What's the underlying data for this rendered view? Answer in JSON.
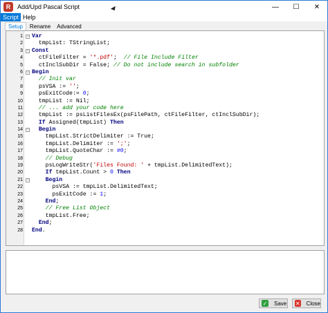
{
  "window": {
    "title": "Add/Upd Pascal Script",
    "minimize_glyph": "—",
    "maximize_glyph": "☐",
    "close_glyph": "✕",
    "app_icon_letter": "R",
    "app_icon_color": "#c0392b"
  },
  "menu": [
    {
      "label": "Script",
      "active": true
    },
    {
      "label": "Help",
      "active": false
    }
  ],
  "tabs": [
    {
      "label": "Setup",
      "active": true
    },
    {
      "label": "Rename",
      "active": false
    },
    {
      "label": "Advanced",
      "active": false
    }
  ],
  "editor": {
    "lines": [
      {
        "n": "1",
        "html": "<span class=\"kw\">Var</span>"
      },
      {
        "n": "2",
        "html": "  tmpList: TStringList;"
      },
      {
        "n": "3",
        "html": "<span class=\"kw\">Const</span>"
      },
      {
        "n": "4",
        "html": "  ctFileFilter = <span class=\"str\">'*.pdf'</span>;  <span class=\"cm\">// File Include Filter</span>"
      },
      {
        "n": "5",
        "html": "  ctInclSubDir = False; <span class=\"cm\">// Do not include search in subfolder</span>"
      },
      {
        "n": "6",
        "html": "<span class=\"kw\">Begin</span>"
      },
      {
        "n": "7",
        "html": "  <span class=\"cm\">// Init var</span>"
      },
      {
        "n": "8",
        "html": "  psVSA := <span class=\"str\">''</span>;"
      },
      {
        "n": "9",
        "html": "  psExitCode:= <span class=\"num\">0</span>;"
      },
      {
        "n": "10",
        "html": "  tmpList := Nil;"
      },
      {
        "n": "11",
        "html": "  <span class=\"cm\">// ... add your code here</span>"
      },
      {
        "n": "12",
        "html": "  tmpList := psListFilesEx(psFilePath, ctFileFilter, ctInclSubDir);"
      },
      {
        "n": "13",
        "html": "  <span class=\"kw\">If</span> Assigned(tmpList) <span class=\"kw\">Then</span>"
      },
      {
        "n": "14",
        "html": "  <span class=\"kw\">Begin</span>"
      },
      {
        "n": "15",
        "html": "    tmpList.StrictDelimiter := True;"
      },
      {
        "n": "16",
        "html": "    tmpList.Delimiter := <span class=\"str\">';'</span>;"
      },
      {
        "n": "17",
        "html": "    tmpList.QuoteChar := <span class=\"num\">#0</span>;"
      },
      {
        "n": "18",
        "html": "    <span class=\"cm\">// Debug</span>"
      },
      {
        "n": "19",
        "html": "    psLogWriteStr(<span class=\"str\">'Files Found: '</span> + tmpList.DelimitedText);"
      },
      {
        "n": "20",
        "html": "    <span class=\"kw\">If</span> tmpList.Count > <span class=\"num\">0</span> <span class=\"kw\">Then</span>"
      },
      {
        "n": "21",
        "html": "    <span class=\"kw\">Begin</span>"
      },
      {
        "n": "22",
        "html": "      psVSA := tmpList.DelimitedText;"
      },
      {
        "n": "23",
        "html": "      psExitCode := <span class=\"num\">1</span>;"
      },
      {
        "n": "24",
        "html": "    <span class=\"kw\">End</span>;"
      },
      {
        "n": "25",
        "html": "    <span class=\"cm\">// Free List Object</span>"
      },
      {
        "n": "26",
        "html": "    tmpList.Free;"
      },
      {
        "n": "27",
        "html": "  <span class=\"kw\">End</span>;"
      },
      {
        "n": "28",
        "html": "<span class=\"kw\">End</span>."
      }
    ],
    "fold_markers": [
      1,
      3,
      6,
      14,
      21
    ]
  },
  "buttons": {
    "save_label": "Save",
    "close_label": "Close",
    "save_icon": "check-icon",
    "close_icon": "cross-icon",
    "save_color": "#2e9e3e",
    "close_color": "#d9342b"
  }
}
